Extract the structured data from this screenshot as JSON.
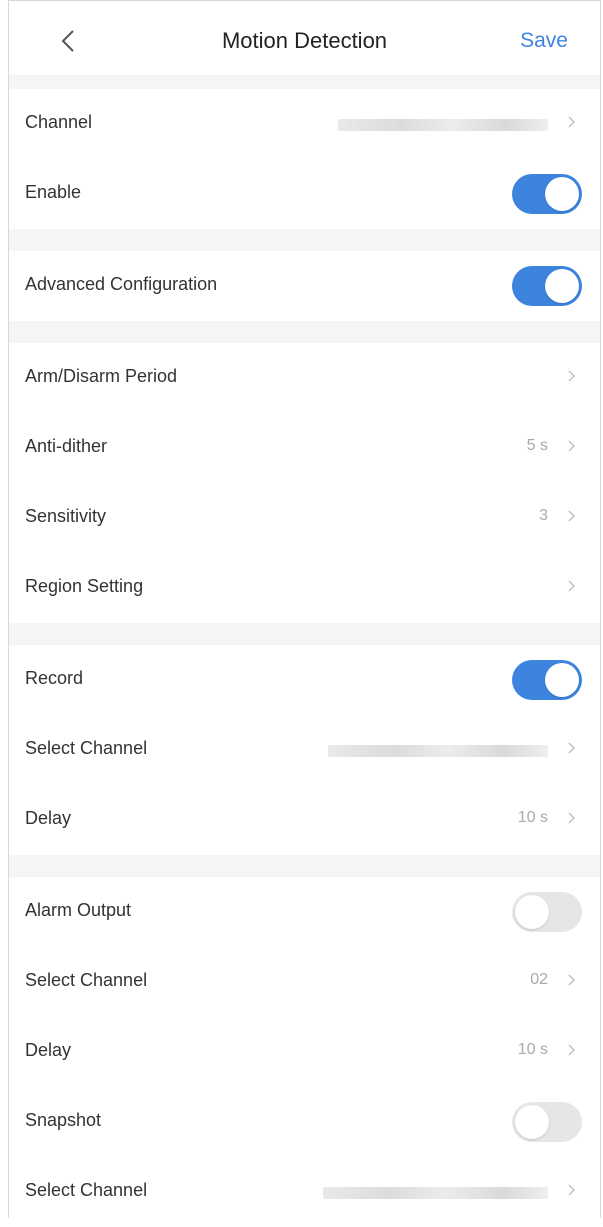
{
  "nav": {
    "title": "Motion Detection",
    "save_label": "Save"
  },
  "accent_color": "#3d84df",
  "sections": {
    "channel": {
      "label": "Channel",
      "value": ""
    },
    "enable": {
      "label": "Enable",
      "on": true
    },
    "advanced": {
      "label": "Advanced Configuration",
      "on": true
    },
    "arm_disarm": {
      "label": "Arm/Disarm Period"
    },
    "anti_dither": {
      "label": "Anti-dither",
      "value": "5 s"
    },
    "sensitivity": {
      "label": "Sensitivity",
      "value": "3"
    },
    "region": {
      "label": "Region Setting"
    },
    "record": {
      "label": "Record",
      "on": true
    },
    "record_channel": {
      "label": "Select Channel",
      "value": ""
    },
    "record_delay": {
      "label": "Delay",
      "value": "10 s"
    },
    "alarm_output": {
      "label": "Alarm Output",
      "on": false
    },
    "alarm_channel": {
      "label": "Select Channel",
      "value": "02"
    },
    "alarm_delay": {
      "label": "Delay",
      "value": "10 s"
    },
    "snapshot": {
      "label": "Snapshot",
      "on": false
    },
    "snapshot_channel": {
      "label": "Select Channel",
      "value": ""
    }
  }
}
